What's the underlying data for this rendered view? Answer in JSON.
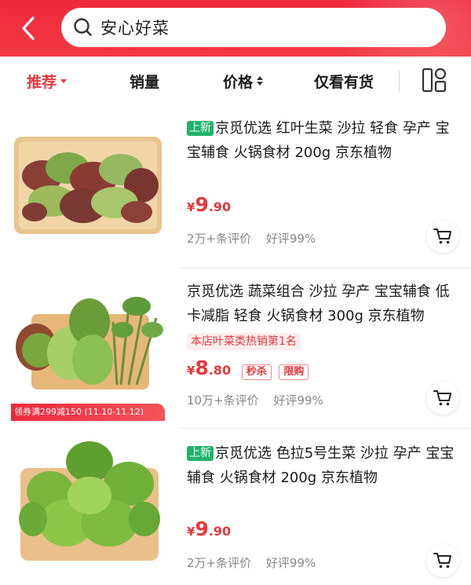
{
  "search": {
    "query": "安心好菜"
  },
  "filters": {
    "recommend": "推荐",
    "sales": "销量",
    "price": "价格",
    "in_stock": "仅看有货"
  },
  "colors": {
    "brand_red": "#e4393c",
    "new_tag_green": "#1fb36b"
  },
  "products": [
    {
      "new_tag": "上新",
      "title": "京觅优选 红叶生菜 沙拉 轻食 孕产 宝宝辅食 火锅食材 200g 京东植物",
      "price_symbol": "¥",
      "price_int": "9",
      "price_dec": ".90",
      "review_count": "2万+条评价",
      "good_rate": "好评99%"
    },
    {
      "title": "京觅优选 蔬菜组合 沙拉 孕产 宝宝辅食 低卡减脂 轻食 火锅食材 300g 京东植物",
      "hot_rank": "本店叶菜类热销第1名",
      "price_symbol": "¥",
      "price_int": "8",
      "price_dec": ".80",
      "promo_tags": [
        "秒杀",
        "限购"
      ],
      "coupon": "领券满299减150 (11.10-11.12)",
      "review_count": "10万+条评价",
      "good_rate": "好评99%"
    },
    {
      "new_tag": "上新",
      "title": "京觅优选 色拉5号生菜 沙拉 孕产 宝宝辅食 火锅食材  200g 京东植物",
      "price_symbol": "¥",
      "price_int": "9",
      "price_dec": ".90",
      "review_count": "2万+条评价",
      "good_rate": "好评99%"
    }
  ]
}
